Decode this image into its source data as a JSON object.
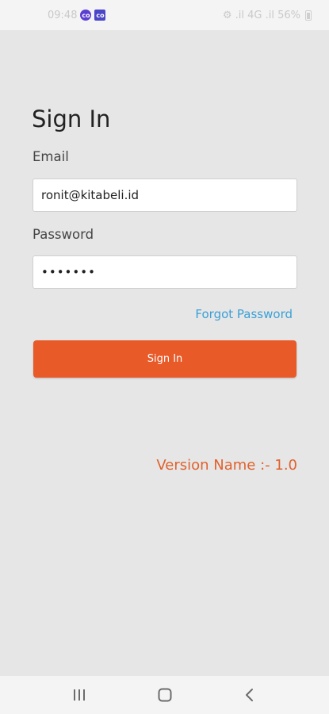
{
  "status_bar": {
    "time": "09:48",
    "badges": [
      "co",
      "co"
    ],
    "right_text": "⚙ .il 4G .il 56%",
    "battery_icon": "battery-icon"
  },
  "page": {
    "title": "Sign In"
  },
  "form": {
    "email_label": "Email",
    "email_value": "ronit@kitabeli.id",
    "password_label": "Password",
    "password_value": "•••••••",
    "forgot_label": "Forgot Password",
    "submit_label": "Sign In"
  },
  "footer": {
    "version_text": "Version Name :- 1.0"
  },
  "nav_bar": {
    "recents_icon": "recents-icon",
    "home_icon": "home-icon",
    "back_icon": "back-icon"
  },
  "colors": {
    "accent": "#e85a28",
    "link": "#3aa0d6",
    "background": "#e6e6e6"
  }
}
